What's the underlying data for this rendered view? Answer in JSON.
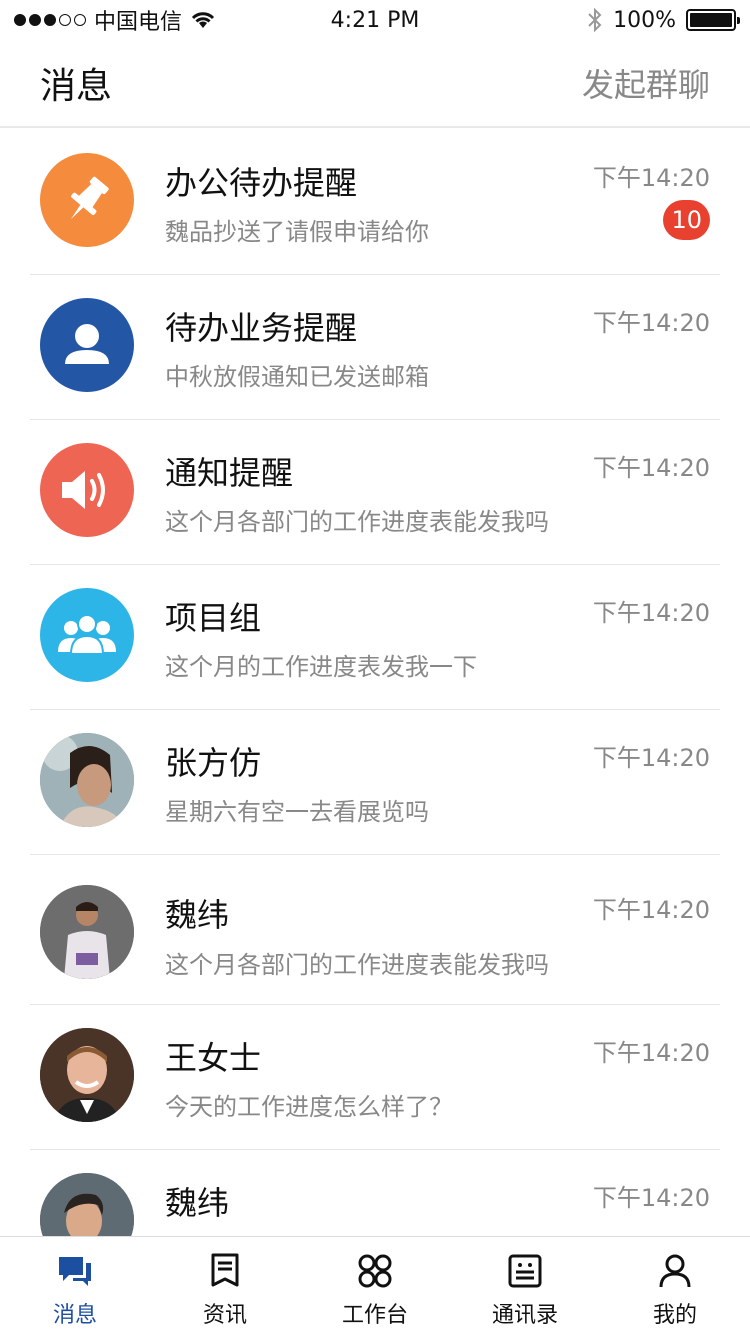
{
  "status_bar": {
    "carrier": "中国电信",
    "time": "4:21 PM",
    "battery": "100%"
  },
  "header": {
    "title": "消息",
    "action": "发起群聊"
  },
  "messages": [
    {
      "title": "办公待办提醒",
      "subtitle": "魏品抄送了请假申请给你",
      "time": "下午14:20",
      "badge": "10",
      "icon": "pin-icon",
      "color": "#f58b3c"
    },
    {
      "title": "待办业务提醒",
      "subtitle": "中秋放假通知已发送邮箱",
      "time": "下午14:20",
      "icon": "user-icon",
      "color": "#2456a6"
    },
    {
      "title": "通知提醒",
      "subtitle": "这个月各部门的工作进度表能发我吗",
      "time": "下午14:20",
      "icon": "speaker-icon",
      "color": "#ef6554"
    },
    {
      "title": "项目组",
      "subtitle": "这个月的工作进度表发我一下",
      "time": "下午14:20",
      "icon": "group-icon",
      "color": "#2eb5e8"
    },
    {
      "title": "张方仿",
      "subtitle": "星期六有空一去看展览吗",
      "time": "下午14:20",
      "icon": "photo-avatar"
    },
    {
      "title": "魏纬",
      "subtitle": "这个月各部门的工作进度表能发我吗",
      "time": "下午14:20",
      "icon": "photo-avatar"
    },
    {
      "title": "王女士",
      "subtitle": "今天的工作进度怎么样了？",
      "time": "下午14:20",
      "icon": "photo-avatar"
    },
    {
      "title": "魏纬",
      "subtitle": "",
      "time": "下午14:20",
      "icon": "photo-avatar"
    }
  ],
  "tabs": [
    {
      "label": "消息",
      "icon": "chat-icon",
      "active": true
    },
    {
      "label": "资讯",
      "icon": "news-icon"
    },
    {
      "label": "工作台",
      "icon": "workbench-icon"
    },
    {
      "label": "通讯录",
      "icon": "contacts-icon"
    },
    {
      "label": "我的",
      "icon": "profile-icon"
    }
  ],
  "colors": {
    "accent": "#1d4fa0",
    "badge": "#e8412f",
    "muted_text": "#888888"
  }
}
